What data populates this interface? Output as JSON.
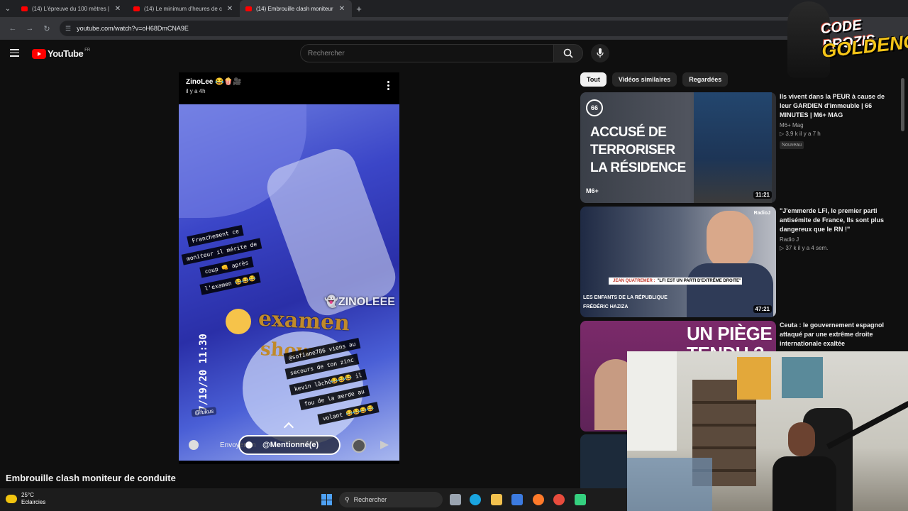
{
  "browser": {
    "tabs": [
      {
        "label": "(14) L'épreuve du 100 mètres | ",
        "active": false
      },
      {
        "label": "(14) Le minimum d'heures de c",
        "active": false
      },
      {
        "label": "(14) Embrouille clash moniteur",
        "active": true
      }
    ],
    "url": "youtube.com/watch?v=oH68DmCNA9E"
  },
  "youtube": {
    "logo_text": "YouTube",
    "country": "FR",
    "search_placeholder": "Rechercher"
  },
  "video": {
    "author": "ZinoLee 😂🍿🎥",
    "age": "il y a 4h",
    "title": "Embrouille clash moniteur de conduite",
    "overlay": {
      "caption1": [
        "Franchement ce",
        "moniteur il mérite de",
        "coup 👊 après",
        "l'examen 😂😂😂"
      ],
      "watermark": "👻ZINOLEEE",
      "big1": "examen",
      "big2": "show",
      "caption2": [
        "@sofiane786 viens au",
        "secours de ton zinc",
        "kevin lâché😂😂😂 il",
        "fou de la merde au",
        "volant 😂😂😂😂"
      ],
      "date": "7/19/20 11:30",
      "tag": "@fukus",
      "reply_placeholder": "Envoyer un",
      "mention": "@Mentionné(e)"
    }
  },
  "filters": [
    "Tout",
    "Vidéos similaires",
    "Regardées"
  ],
  "recommendations": [
    {
      "title": "Ils vivent dans la PEUR à cause de leur GARDIEN d'immeuble | 66 MINUTES | M6+ MAG",
      "channel": "M6+ Mag",
      "meta": "▷ 3,9 k  il y a 7 h",
      "badge": "Nouveau",
      "duration": "11:21",
      "thumb_text": [
        "ACCUSÉ DE",
        "TERRORISER",
        "LA RÉSIDENCE"
      ],
      "thumb_logo": "66",
      "thumb_brand": "M6+"
    },
    {
      "title": "\"J'emmerde LFI, le premier parti antisémite de France, Ils sont plus dangereux que le RN !\"",
      "channel": "Radio J",
      "meta": "▷ 37 k  il y a 4 sem.",
      "duration": "47:21",
      "thumb_banner_name": "JEAN QUATREMER :",
      "thumb_banner_text": "\"LFI EST UN PARTI D'EXTRÊME DROITE\"",
      "thumb_label1": "LES ENFANTS DE LA RÉPUBLIQUE",
      "thumb_label2": "FRÉDÉRIC HAZIZA",
      "thumb_radio": "RadioJ"
    },
    {
      "title": "Ceuta : le gouvernement espagnol attaqué par une extrême droite internationale exaltée",
      "thumb_text": [
        "UN PIÈGE",
        "TENDU ?"
      ]
    }
  ],
  "brand_overlay": {
    "line1": "CODE PROZIS",
    "line2": "GOLDENG"
  },
  "taskbar": {
    "temp": "25°C",
    "weather": "Eclaircies",
    "search": "Rechercher"
  },
  "colors": {
    "yt_red": "#ff0000",
    "bg": "#0f0f0f",
    "accent_gold": "#f5c518"
  }
}
